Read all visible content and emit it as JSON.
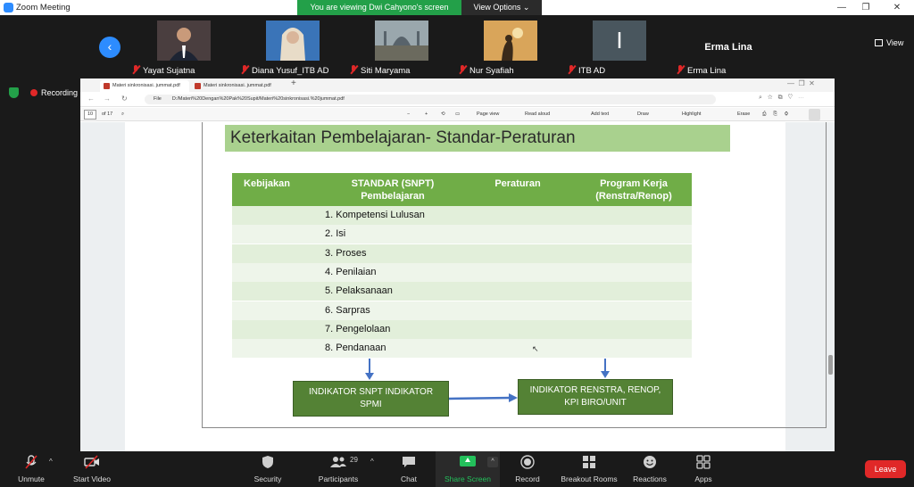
{
  "app": {
    "title": "Zoom Meeting",
    "viewing_banner": "You are viewing Dwi Cahyono's screen",
    "view_options": "View Options ⌄",
    "view_button": "View",
    "recording": "Recording"
  },
  "participants": [
    {
      "name": "Yayat Sujatna",
      "photo_color": "#5a4a48"
    },
    {
      "name": "Diana Yusuf_ITB AD",
      "photo_color": "#3a74b8"
    },
    {
      "name": "Siti Maryama",
      "photo_color": "#7b8a8f"
    },
    {
      "name": "Nur Syafiah",
      "photo_color": "#b58945"
    },
    {
      "name": "ITB AD",
      "initial": "I",
      "photo_color": "#49565e"
    },
    {
      "name": "Erma Lina",
      "display": "Erma Lina"
    }
  ],
  "browser": {
    "tabs": [
      "Materi sinkronisasi. jummat.pdf",
      "Materi sinkronisasi. jummat.pdf"
    ],
    "file_label": "File",
    "url": "D:/Materi%20Dengan%20Pak%20Supit/Materi%20sinkronisasi.%20jummat.pdf",
    "page_number": "10",
    "page_of": "of 17",
    "toolbar": {
      "minus": "−",
      "plus": "+",
      "page_view": "Page view",
      "read_aloud": "Read aloud",
      "add_text": "Add text",
      "draw": "Draw",
      "highlight": "Highlight",
      "erase": "Erase"
    }
  },
  "slide": {
    "title": "Keterkaitan Pembelajaran- Standar-Peraturan",
    "headers": {
      "kebijakan": "Kebijakan",
      "standar_1": "STANDAR (SNPT)",
      "standar_2": "Pembelajaran",
      "peraturan": "Peraturan",
      "program_1": "Program Kerja",
      "program_2": "(Renstra/Renop)"
    },
    "rows": [
      "1. Kompetensi Lulusan",
      "2. Isi",
      "3. Proses",
      "4. Penilaian",
      "5. Pelaksanaan",
      "6. Sarpras",
      "7. Pengelolaan",
      "8. Pendanaan"
    ],
    "box_left": {
      "line1": "INDIKATOR SNPT INDIKATOR",
      "line2": "SPMI"
    },
    "box_right": {
      "line1": "INDIKATOR RENSTRA, RENOP,",
      "line2": "KPI BIRO/UNIT"
    },
    "arrow_color": "#4472c4",
    "header_color": "#70ad47",
    "box_color": "#548235"
  },
  "toolbar": {
    "unmute": "Unmute",
    "start_video": "Start Video",
    "security": "Security",
    "participants": "Participants",
    "participant_count": "29",
    "chat": "Chat",
    "share_screen": "Share Screen",
    "record": "Record",
    "breakout_rooms": "Breakout Rooms",
    "reactions": "Reactions",
    "apps": "Apps",
    "leave": "Leave"
  }
}
